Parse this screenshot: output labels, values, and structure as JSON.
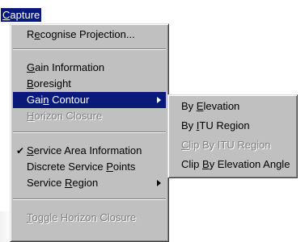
{
  "menu_title": {
    "pre": "",
    "key": "C",
    "post": "apture"
  },
  "main_menu": {
    "items": [
      {
        "pre": "R",
        "key": "e",
        "post": "cognise Projection..."
      },
      {
        "pre": "",
        "key": "G",
        "post": "ain Information"
      },
      {
        "pre": "",
        "key": "B",
        "post": "oresight"
      },
      {
        "pre": "Gai",
        "key": "n",
        "post": " Contour"
      },
      {
        "pre": "",
        "key": "H",
        "post": "orizon Closure"
      },
      {
        "pre": "",
        "key": "S",
        "post": "ervice Area Information"
      },
      {
        "pre": "Discrete Service ",
        "key": "P",
        "post": "oints"
      },
      {
        "pre": "Service ",
        "key": "R",
        "post": "egion"
      },
      {
        "pre": "",
        "key": "T",
        "post": "oggle Horizon Closure"
      }
    ],
    "check_glyph": "✔"
  },
  "sub_menu": {
    "items": [
      {
        "pre": "By ",
        "key": "E",
        "post": "levation"
      },
      {
        "pre": "By ",
        "key": "I",
        "post": "TU Region"
      },
      {
        "pre": "",
        "key": "C",
        "post": "lip By ITU Region"
      },
      {
        "pre": "Clip ",
        "key": "B",
        "post": "y Elevation Angle"
      }
    ]
  }
}
